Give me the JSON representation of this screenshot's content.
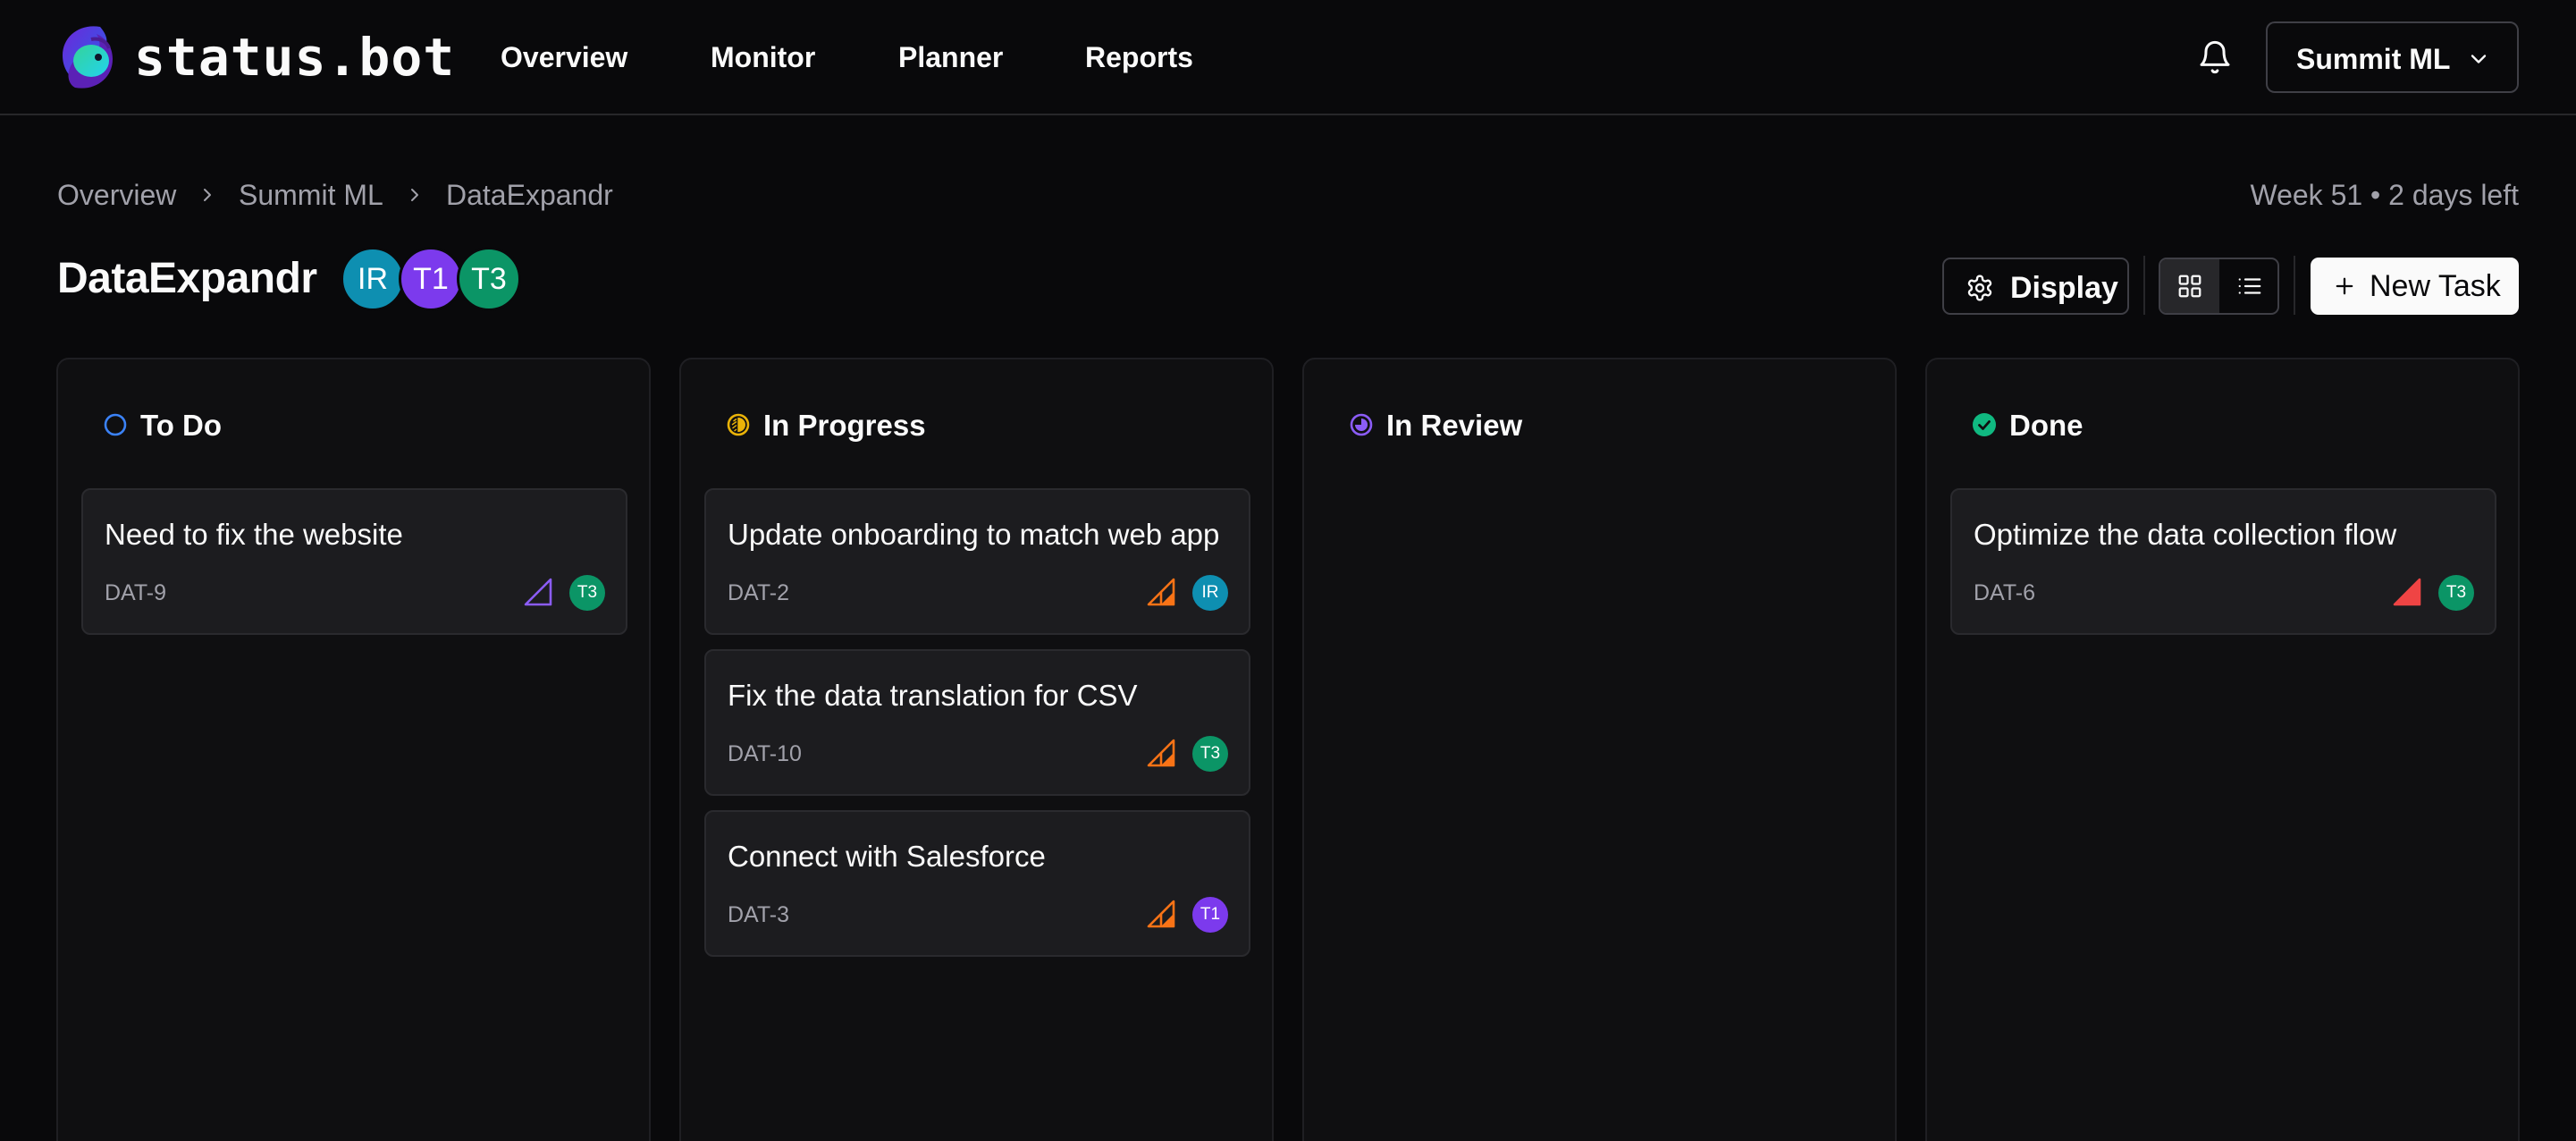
{
  "app": {
    "logo_text": "status.bot"
  },
  "nav": {
    "links": [
      "Overview",
      "Monitor",
      "Planner",
      "Reports"
    ]
  },
  "workspace": {
    "name": "Summit ML"
  },
  "breadcrumb": [
    "Overview",
    "Summit ML",
    "DataExpandr"
  ],
  "week_info": "Week 51 • 2 days left",
  "project": {
    "title": "DataExpandr",
    "members": [
      {
        "initials": "IR",
        "color": "#0e8fb1"
      },
      {
        "initials": "T1",
        "color": "#7c3aed"
      },
      {
        "initials": "T3",
        "color": "#0b9566"
      }
    ]
  },
  "toolbar": {
    "display_label": "Display",
    "new_task_label": "New Task"
  },
  "columns": [
    {
      "title": "To Do",
      "status_icon": "todo-circle-icon",
      "color": "#3b82f6",
      "cards": [
        {
          "title": "Need to fix the website",
          "id": "DAT-9",
          "priority": "low",
          "priority_color": "#8b5cf6",
          "assignee": "T3",
          "assignee_color": "#0b9566"
        }
      ]
    },
    {
      "title": "In Progress",
      "status_icon": "in-progress-icon",
      "color": "#eab308",
      "cards": [
        {
          "title": "Update onboarding to match web app",
          "id": "DAT-2",
          "priority": "medium",
          "priority_color": "#f97316",
          "assignee": "IR",
          "assignee_color": "#0e8fb1"
        },
        {
          "title": "Fix the data translation for CSV",
          "id": "DAT-10",
          "priority": "medium",
          "priority_color": "#f97316",
          "assignee": "T3",
          "assignee_color": "#0b9566"
        },
        {
          "title": "Connect with Salesforce",
          "id": "DAT-3",
          "priority": "medium",
          "priority_color": "#f97316",
          "assignee": "T1",
          "assignee_color": "#7c3aed"
        }
      ]
    },
    {
      "title": "In Review",
      "status_icon": "in-review-icon",
      "color": "#8b5cf6",
      "cards": []
    },
    {
      "title": "Done",
      "status_icon": "done-check-icon",
      "color": "#10b981",
      "cards": [
        {
          "title": "Optimize the data collection flow",
          "id": "DAT-6",
          "priority": "high",
          "priority_color": "#ef4444",
          "assignee": "T3",
          "assignee_color": "#0b9566"
        }
      ]
    }
  ]
}
